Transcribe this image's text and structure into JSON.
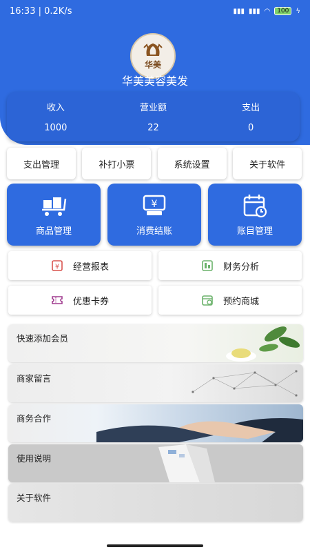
{
  "status_bar": {
    "time_speed": "16:33 | 0.2K/s",
    "battery": "100"
  },
  "app": {
    "logo_text": "华美",
    "title": "华美美容美发"
  },
  "stats": [
    {
      "label": "收入",
      "value": "1000"
    },
    {
      "label": "营业额",
      "value": "22"
    },
    {
      "label": "支出",
      "value": "0"
    }
  ],
  "quick_actions": [
    "支出管理",
    "补打小票",
    "系统设置",
    "关于软件"
  ],
  "main_actions": [
    "商品管理",
    "消费结账",
    "账目管理"
  ],
  "secondary_actions": [
    "经营报表",
    "财务分析",
    "优惠卡券",
    "预约商城"
  ],
  "banners": [
    "快速添加会员",
    "商家留言",
    "商务合作",
    "使用说明",
    "关于软件"
  ],
  "colors": {
    "primary": "#2f6be0",
    "icon_red": "#d9534f",
    "icon_green": "#6bb26b"
  }
}
